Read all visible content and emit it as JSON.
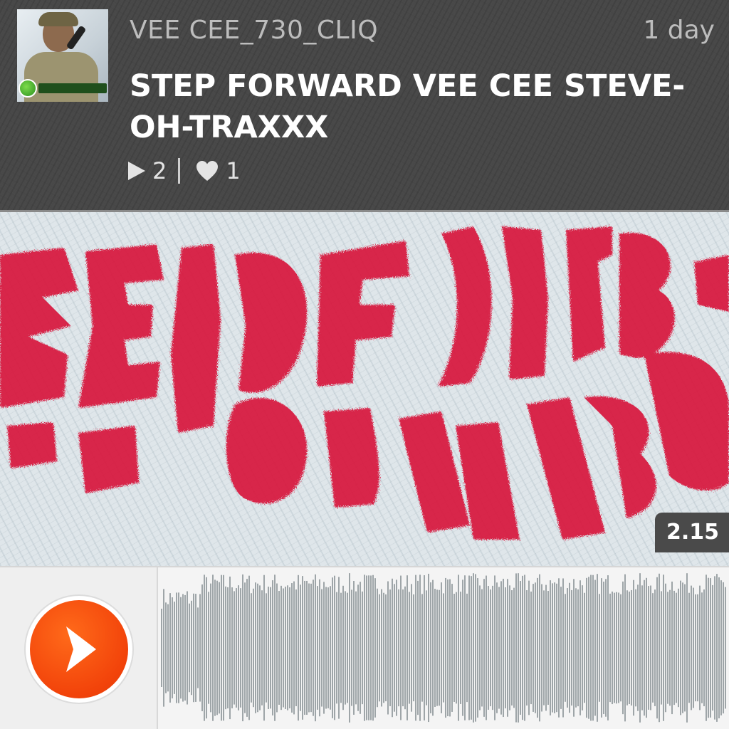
{
  "track": {
    "username": "VEE CEE_730_CLIQ",
    "timestamp": "1 day",
    "title": "STEP FORWARD VEE CEE STEVE-OH-TRAXXX",
    "play_count": "2",
    "like_count": "1",
    "duration": "2.15"
  },
  "icons": {
    "play_count": "play-triangle",
    "likes": "heart",
    "play_button": "play-chevron"
  },
  "colors": {
    "header_bg": "#454545",
    "accent_orange": "#f2430a",
    "artwork_red": "#d8163c",
    "waveform": "#9ea5a8"
  }
}
